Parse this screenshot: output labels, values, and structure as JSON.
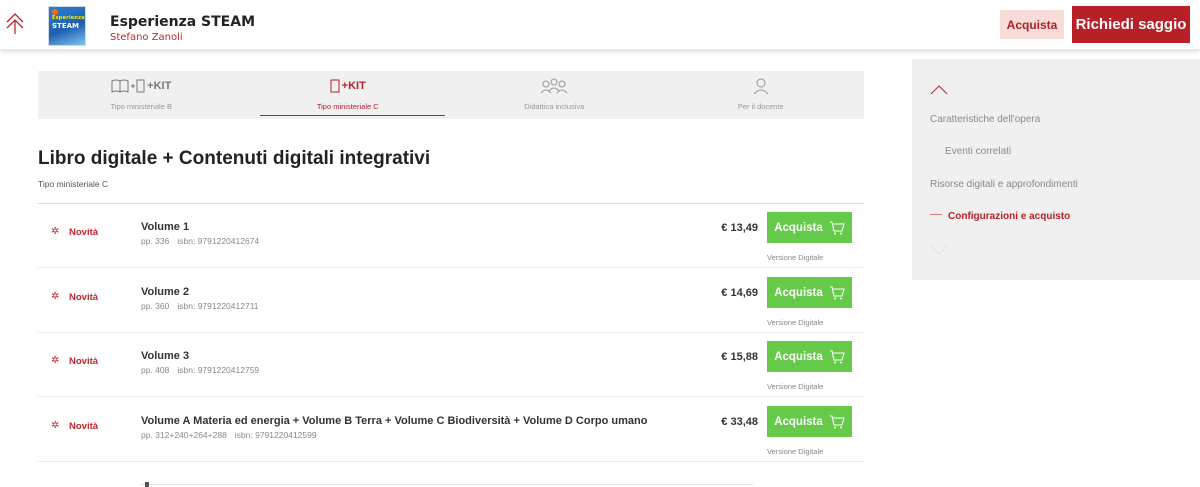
{
  "header": {
    "book_title": "Esperienza STEAM",
    "book_author": "Stefano Zanoli",
    "cover_text_small": "Esperienza",
    "cover_text_big": "STEAM",
    "buy_label": "Acquista",
    "sample_label": "Richiedi saggio"
  },
  "tabs": [
    {
      "icon": "book-device-kit-icon",
      "icon_text": "+KIT",
      "label": "Tipo ministeriale B",
      "active": false
    },
    {
      "icon": "device-kit-icon",
      "icon_text": "+KIT",
      "label": "Tipo ministeriale C",
      "active": true
    },
    {
      "icon": "people-group-icon",
      "icon_text": "",
      "label": "Didattica inclusiva",
      "active": false
    },
    {
      "icon": "person-icon",
      "icon_text": "",
      "label": "Per il docente",
      "active": false
    }
  ],
  "section": {
    "title": "Libro digitale + Contenuti digitali integrativi",
    "subtitle": "Tipo ministeriale C"
  },
  "products": [
    {
      "badge": "Novità",
      "title": "Volume 1",
      "pages": "pp. 336",
      "isbn": "isbn: 9791220412674",
      "price": "€ 13,49",
      "buy_label": "Acquista",
      "version": "Versione Digitale"
    },
    {
      "badge": "Novità",
      "title": "Volume 2",
      "pages": "pp. 360",
      "isbn": "isbn: 9791220412711",
      "price": "€ 14,69",
      "buy_label": "Acquista",
      "version": "Versione Digitale"
    },
    {
      "badge": "Novità",
      "title": "Volume 3",
      "pages": "pp. 408",
      "isbn": "isbn: 9791220412759",
      "price": "€ 15,88",
      "buy_label": "Acquista",
      "version": "Versione Digitale"
    },
    {
      "badge": "Novità",
      "title": "Volume A Materia ed energia + Volume B Terra + Volume C Biodiversità + Volume D Corpo umano",
      "pages": "pp. 312+240+264+288",
      "isbn": "isbn: 9791220412599",
      "price": "€ 33,48",
      "buy_label": "Acquista",
      "version": "Versione Digitale"
    }
  ],
  "sidebar": {
    "items": [
      {
        "label": "Caratteristiche dell'opera",
        "active": false
      },
      {
        "label": "Eventi correlati",
        "active": false
      },
      {
        "label": "Risorse digitali e approfondimenti",
        "active": false
      },
      {
        "label": "Configurazioni e acquisto",
        "active": true
      }
    ]
  },
  "colors": {
    "brand_red": "#b81f27",
    "buy_green": "#65c94a",
    "panel_gray": "#f0f0f0"
  }
}
